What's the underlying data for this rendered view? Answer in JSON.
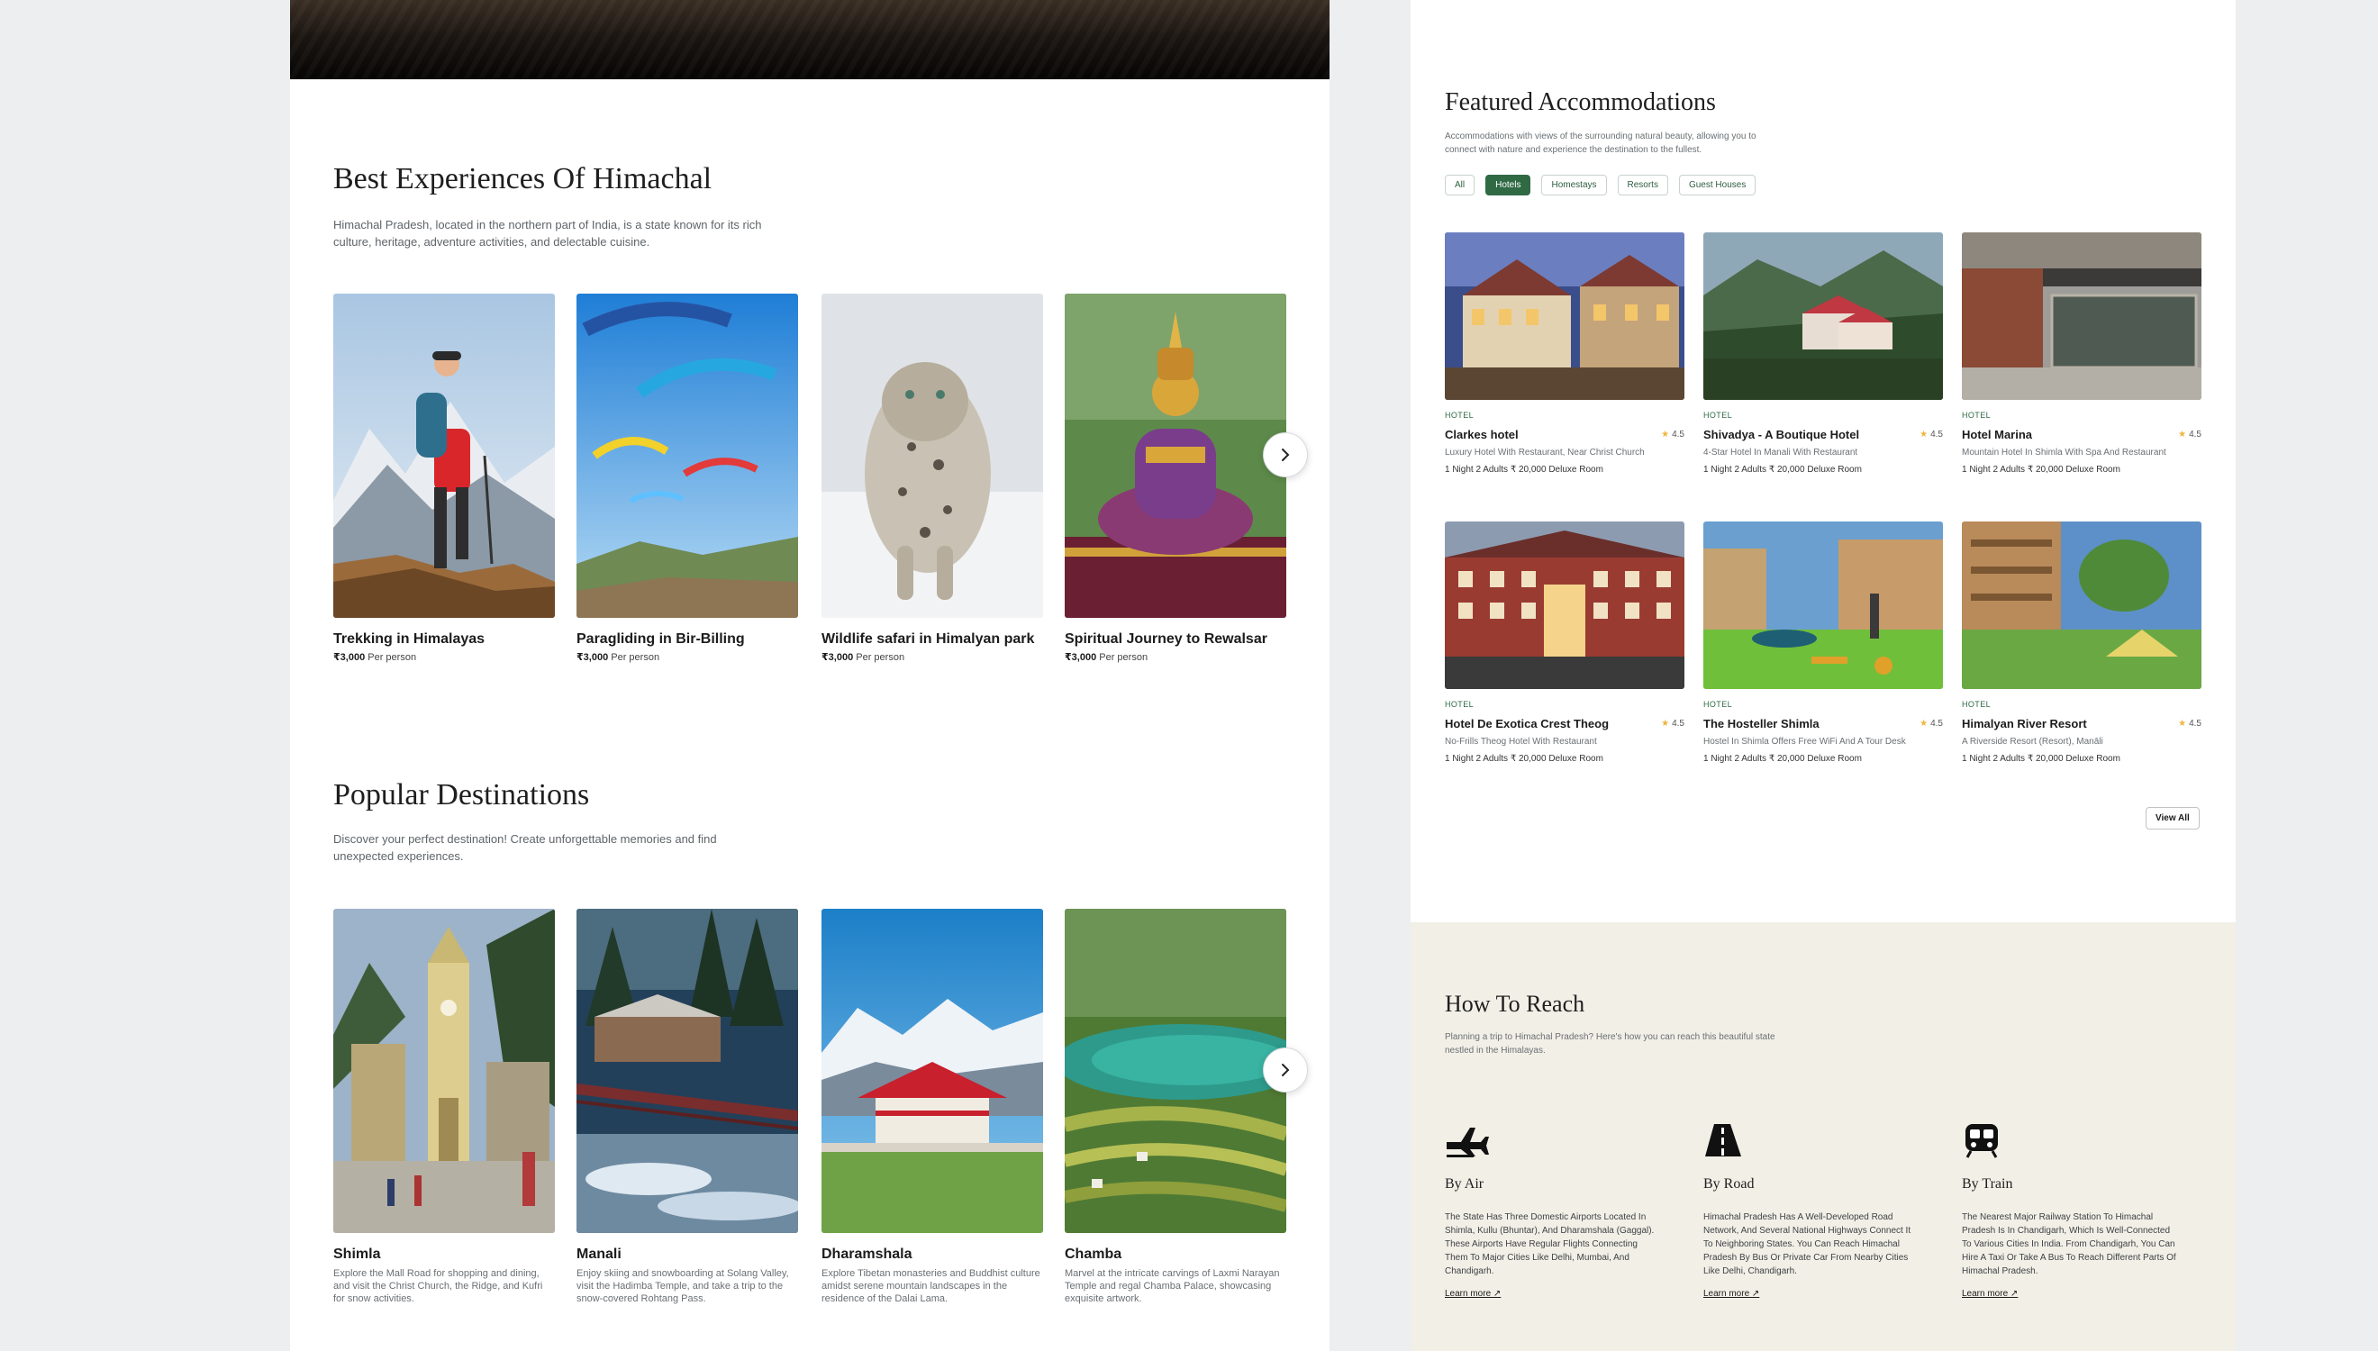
{
  "experiences": {
    "title": "Best Experiences Of Himachal",
    "description": "Himachal Pradesh, located in the northern part of India, is a state known for its rich culture, heritage, adventure activities, and delectable cuisine.",
    "price_suffix": "Per person",
    "items": [
      {
        "name": "Trekking in Himalayas",
        "price": "₹3,000"
      },
      {
        "name": "Paragliding in Bir-Billing",
        "price": "₹3,000"
      },
      {
        "name": "Wildlife safari in Himalyan park",
        "price": "₹3,000"
      },
      {
        "name": "Spiritual Journey to Rewalsar",
        "price": "₹3,000"
      }
    ]
  },
  "destinations": {
    "title": "Popular Destinations",
    "description": "Discover your perfect destination!  Create unforgettable memories and find unexpected experiences.",
    "items": [
      {
        "name": "Shimla",
        "text": "Explore the Mall Road for shopping and dining, and visit the Christ Church, the Ridge, and Kufri for snow activities."
      },
      {
        "name": "Manali",
        "text": "Enjoy skiing and snowboarding at Solang Valley, visit the Hadimba Temple, and take a trip to the snow-covered Rohtang Pass."
      },
      {
        "name": "Dharamshala",
        "text": "Explore Tibetan monasteries and Buddhist culture amidst serene mountain landscapes in the residence of the Dalai Lama."
      },
      {
        "name": "Chamba",
        "text": "Marvel at the intricate carvings of Laxmi Narayan Temple and regal Chamba Palace, showcasing exquisite artwork."
      }
    ]
  },
  "accommodations": {
    "title": "Featured Accommodations",
    "description": "Accommodations with views of the surrounding natural beauty, allowing you to connect with nature and experience the destination to the fullest.",
    "filters": [
      "All",
      "Hotels",
      "Homestays",
      "Resorts",
      "Guest Houses"
    ],
    "active_filter": "Hotels",
    "view_all": "View All",
    "items": [
      {
        "type": "HOTEL",
        "name": "Clarkes hotel",
        "rating": "4.5",
        "sub": "Luxury Hotel With Restaurant, Near Christ Church",
        "meta": "1 Night 2 Adults ₹ 20,000 Deluxe Room"
      },
      {
        "type": "HOTEL",
        "name": "Shivadya - A Boutique Hotel",
        "rating": "4.5",
        "sub": "4-Star Hotel In Manali With Restaurant",
        "meta": "1 Night 2 Adults ₹ 20,000 Deluxe Room"
      },
      {
        "type": "HOTEL",
        "name": "Hotel Marina",
        "rating": "4.5",
        "sub": "Mountain Hotel In Shimla With Spa And Restaurant",
        "meta": "1 Night 2 Adults ₹ 20,000 Deluxe Room"
      },
      {
        "type": "HOTEL",
        "name": "Hotel De Exotica Crest Theog",
        "rating": "4.5",
        "sub": "No-Frills Theog Hotel With Restaurant",
        "meta": "1 Night 2 Adults ₹ 20,000 Deluxe Room"
      },
      {
        "type": "HOTEL",
        "name": "The Hosteller Shimla",
        "rating": "4.5",
        "sub": "Hostel In Shimla Offers Free WiFi And A Tour Desk",
        "meta": "1 Night 2 Adults ₹ 20,000 Deluxe Room"
      },
      {
        "type": "HOTEL",
        "name": "Himalyan River Resort",
        "rating": "4.5",
        "sub": "A Riverside Resort (Resort), Manāli",
        "meta": "1 Night 2 Adults ₹ 20,000 Deluxe Room"
      }
    ]
  },
  "reach": {
    "title": "How To Reach",
    "description": "Planning a trip to Himachal Pradesh? Here's how you can reach this beautiful state nestled in the Himalayas.",
    "learn_more": "Learn more ↗",
    "items": [
      {
        "icon": "airplane-icon",
        "title": "By Air",
        "text": "The State Has Three Domestic Airports Located In Shimla, Kullu (Bhuntar), And Dharamshala (Gaggal). These Airports Have Regular Flights Connecting Them To Major Cities Like Delhi, Mumbai, And Chandigarh."
      },
      {
        "icon": "road-icon",
        "title": "By Road",
        "text": "Himachal Pradesh Has A Well-Developed Road Network, And Several National Highways Connect It To Neighboring States. You Can Reach Himachal Pradesh By Bus Or Private Car From Nearby Cities Like Delhi, Chandigarh."
      },
      {
        "icon": "train-icon",
        "title": "By Train",
        "text": "The Nearest Major Railway Station To Himachal Pradesh Is In Chandigarh, Which Is Well-Connected To Various Cities In India. From Chandigarh, You Can Hire A Taxi Or Take A Bus To Reach Different Parts Of Himachal Pradesh."
      }
    ]
  },
  "colors": {
    "accent": "#2f6a45",
    "star": "#f0b53a",
    "reach_bg": "#f2efe7"
  }
}
